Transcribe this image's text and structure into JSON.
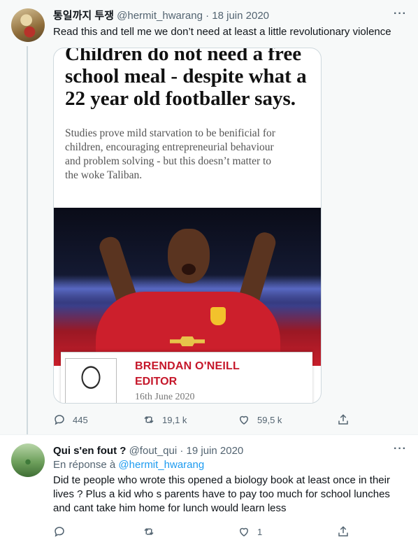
{
  "tweets": [
    {
      "author_name": "통일까지 투쟁",
      "handle": "@hermit_hwarang",
      "separator": "·",
      "date": "18 juin 2020",
      "more": "···",
      "text": "Read this and tell me we don’t need at least a little revolutionary violence",
      "media": {
        "headline": "Children do not need a free school meal - despite what a 22 year old footballer says.",
        "subtext": "Studies prove mild starvation to be benificial for children, encouraging entrepreneurial behaviour and problem solving - but this doesn’t matter to the woke Taliban.",
        "author": "BRENDAN O'NEILL",
        "role": "EDITOR",
        "pub_date": "16th June 2020"
      },
      "actions": {
        "replies": "445",
        "retweets": "19,1 k",
        "likes": "59,5 k"
      }
    },
    {
      "author_name": "Qui s'en fout ?",
      "handle": "@fout_qui",
      "separator": "·",
      "date": "19 juin 2020",
      "more": "···",
      "reply_prefix": "En réponse à",
      "reply_handle": "@hermit_hwarang",
      "text": "Did te people who wrote this opened a biology book at least once in their lives ? Plus a kid who s parents have to pay too much for school lunches and cant take him home for lunch would learn less",
      "actions": {
        "replies": "",
        "retweets": "",
        "likes": "1"
      }
    }
  ],
  "icons": [
    "reply-icon",
    "retweet-icon",
    "like-icon",
    "share-icon",
    "more-icon"
  ],
  "colors": {
    "accent": "#1d9bf0",
    "muted": "#536471",
    "thread_bg": "#f7f9f9",
    "article_red": "#c5172a"
  }
}
